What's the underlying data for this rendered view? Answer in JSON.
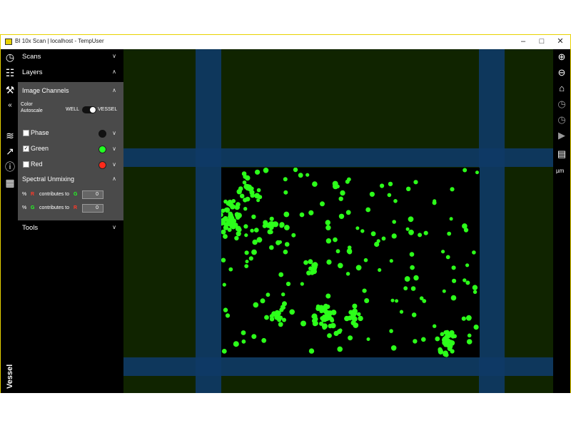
{
  "window": {
    "title": "BI 10x Scan | localhost - TempUser"
  },
  "panel": {
    "sections": {
      "scans": "Scans",
      "layers": "Layers",
      "tools": "Tools"
    },
    "image_channels": {
      "title": "Image Channels",
      "color_autoscale": "Color Autoscale",
      "toggle_left": "WELL",
      "toggle_right": "VESSEL",
      "channels": [
        {
          "label": "Phase",
          "checked": false,
          "color": "#000000"
        },
        {
          "label": "Green",
          "checked": true,
          "color": "#22ff22"
        },
        {
          "label": "Red",
          "checked": false,
          "color": "#ff2a1a"
        }
      ]
    },
    "spectral_unmixing": {
      "title": "Spectral Unmixing",
      "rows": [
        {
          "pct": "%",
          "from": "R",
          "text": "contributes to",
          "to": "G",
          "value": "0"
        },
        {
          "pct": "%",
          "from": "G",
          "text": "contributes to",
          "to": "R",
          "value": "0"
        }
      ]
    },
    "vessel_label": "Vessel"
  },
  "toolbar_right": {
    "unit": "µm"
  },
  "icons": {
    "rail": [
      "clock-icon",
      "sliders-icon",
      "wrench-icon",
      "collapse-icon",
      "graph-settings-icon",
      "graph-icon",
      "info-icon",
      "image-icon"
    ],
    "right": [
      "zoom-in-icon",
      "zoom-out-icon",
      "home-icon",
      "history-icon",
      "history2-icon",
      "play-icon",
      "ruler-icon"
    ]
  }
}
